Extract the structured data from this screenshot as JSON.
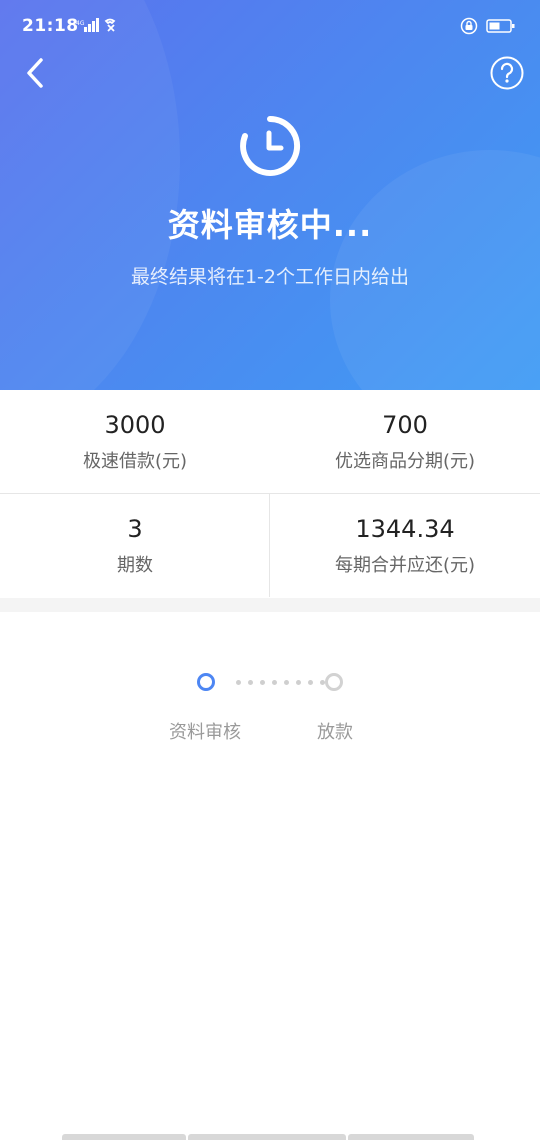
{
  "status_bar": {
    "time": "21:18",
    "signal_label": "4G"
  },
  "header": {
    "title": "资料审核中...",
    "subtitle": "最终结果将在1-2个工作日内给出",
    "gradient_start": "#5a73ee",
    "gradient_end": "#3f9cf5",
    "icons": [
      "back-arrow-icon",
      "help-icon",
      "clock-icon"
    ]
  },
  "stats": [
    {
      "value": "3000",
      "label": "极速借款(元)"
    },
    {
      "value": "700",
      "label": "优选商品分期(元)"
    },
    {
      "value": "3",
      "label": "期数"
    },
    {
      "value": "1344.34",
      "label": "每期合并应还(元)"
    }
  ],
  "progress": {
    "steps": [
      {
        "label": "资料审核",
        "active": true
      },
      {
        "label": "放款",
        "active": false
      }
    ],
    "accent_color": "#4d86f3"
  }
}
